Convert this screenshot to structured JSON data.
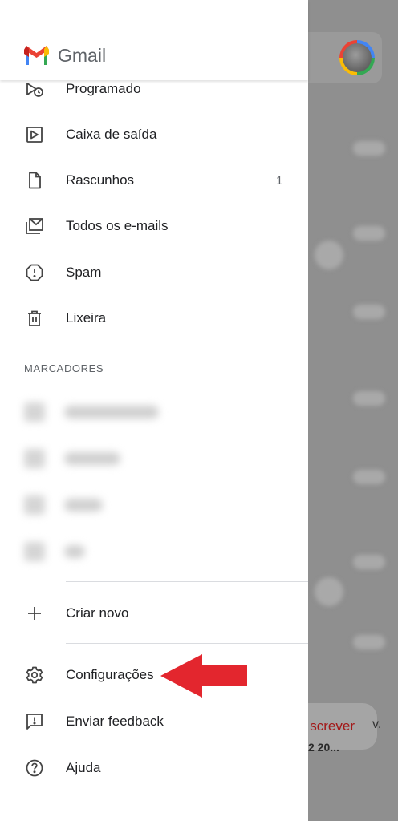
{
  "header": {
    "app_name": "Gmail"
  },
  "nav": {
    "items": [
      {
        "label": "Programado",
        "icon": "scheduled-icon"
      },
      {
        "label": "Caixa de saída",
        "icon": "outbox-icon"
      },
      {
        "label": "Rascunhos",
        "icon": "draft-icon",
        "count": "1"
      },
      {
        "label": "Todos os e-mails",
        "icon": "all-mail-icon"
      },
      {
        "label": "Spam",
        "icon": "spam-icon"
      },
      {
        "label": "Lixeira",
        "icon": "trash-icon"
      }
    ]
  },
  "labels_section": {
    "title": "MARCADORES"
  },
  "actions": {
    "create_new": "Criar novo",
    "settings": "Configurações",
    "feedback": "Enviar feedback",
    "help": "Ajuda"
  },
  "background": {
    "compose_label": "screver",
    "compose_suffix": "v.",
    "snippet": "2 20..."
  },
  "colors": {
    "accent_red": "#EA4335",
    "annotation_arrow": "#E3262E"
  }
}
